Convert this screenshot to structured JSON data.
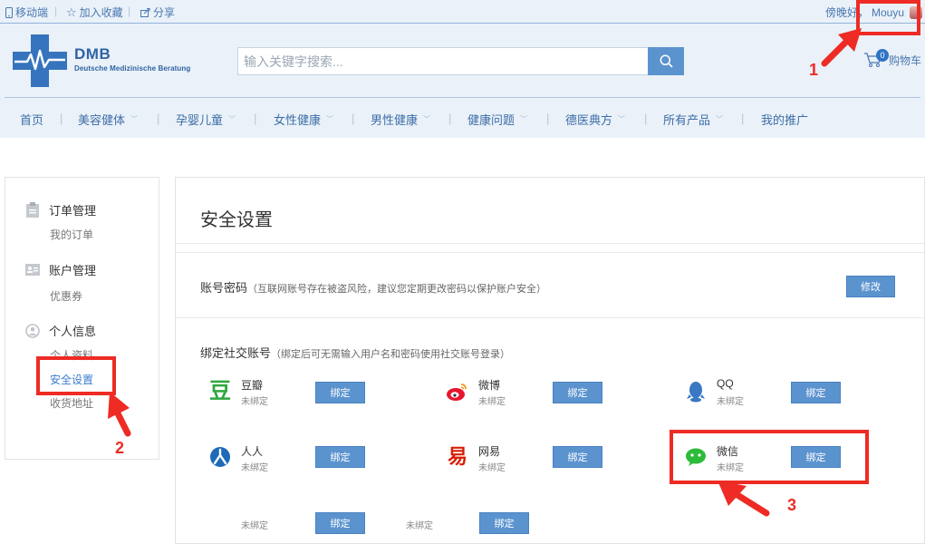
{
  "topbar": {
    "mobile": "移动端",
    "favorite": "加入收藏",
    "share": "分享",
    "greeting": "傍晚好，",
    "username": "Mouyu"
  },
  "brand": {
    "name": "DMB",
    "subtitle": "Deutsche Medizinische Beratung"
  },
  "search": {
    "placeholder": "输入关键字搜索..."
  },
  "cart": {
    "label": "购物车",
    "count": "0"
  },
  "nav": [
    {
      "label": "首页"
    },
    {
      "label": "美容健体"
    },
    {
      "label": "孕婴儿童"
    },
    {
      "label": "女性健康"
    },
    {
      "label": "男性健康"
    },
    {
      "label": "健康问题"
    },
    {
      "label": "德医典方"
    },
    {
      "label": "所有产品"
    },
    {
      "label": "我的推广"
    }
  ],
  "sidebar": {
    "sections": [
      {
        "title": "订单管理",
        "links": [
          "我的订单"
        ]
      },
      {
        "title": "账户管理",
        "links": [
          "优惠券"
        ]
      },
      {
        "title": "个人信息",
        "links": [
          "个人资料",
          "安全设置",
          "收货地址"
        ]
      }
    ]
  },
  "main": {
    "title": "安全设置",
    "password": {
      "label": "账号密码",
      "note": "（互联网账号存在被盗风险，建议您定期更改密码以保护账户安全）",
      "button": "修改"
    },
    "social": {
      "label": "绑定社交账号",
      "note": "（绑定后可无需输入用户名和密码使用社交账号登录）",
      "accounts": [
        {
          "name": "豆瓣",
          "status": "未绑定",
          "button": "绑定",
          "icon": "douban-icon"
        },
        {
          "name": "微博",
          "status": "未绑定",
          "button": "绑定",
          "icon": "weibo-icon"
        },
        {
          "name": "QQ",
          "status": "未绑定",
          "button": "绑定",
          "icon": "qq-icon"
        },
        {
          "name": "人人",
          "status": "未绑定",
          "button": "绑定",
          "icon": "renren-icon"
        },
        {
          "name": "网易",
          "status": "未绑定",
          "button": "绑定",
          "icon": "netease-icon"
        },
        {
          "name": "微信",
          "status": "未绑定",
          "button": "绑定",
          "icon": "wechat-icon"
        },
        {
          "name": "",
          "status": "未绑定",
          "button": "绑定"
        },
        {
          "name": "",
          "status": "未绑定",
          "button": "绑定"
        }
      ]
    }
  },
  "annotations": [
    "1",
    "2",
    "3"
  ],
  "colors": {
    "accent": "#5b93cf",
    "header_bg": "#eaf1f8",
    "annotation_red": "#ee2b24"
  }
}
